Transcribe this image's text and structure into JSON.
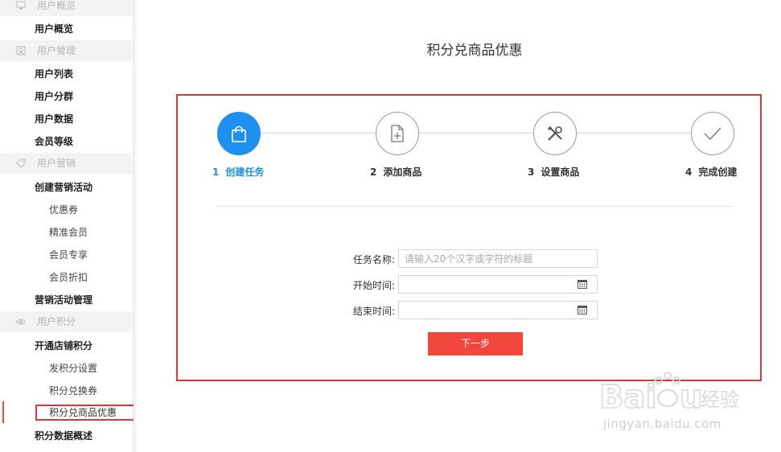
{
  "sidebar": {
    "groups": [
      {
        "label": "用户概览",
        "icon": "monitor-icon"
      },
      {
        "label": "用户管理",
        "icon": "user-card-icon"
      },
      {
        "label": "用户营销",
        "icon": "tag-icon"
      },
      {
        "label": "用户积分",
        "icon": "eye-icon"
      }
    ],
    "items": {
      "overview": "用户概览",
      "user_list": "用户列表",
      "user_group": "用户分群",
      "user_data": "用户数据",
      "member_level": "会员等级",
      "create_campaign": "创建营销活动",
      "coupon": "优惠券",
      "precise_member": "精准会员",
      "member_exclusive": "会员专享",
      "member_discount": "会员折扣",
      "campaign_manage": "营销活动管理",
      "open_points": "开通店铺积分",
      "issue_points": "发积分设置",
      "points_coupon": "积分兑换券",
      "points_goods": "积分兑商品优惠",
      "points_overview": "积分数据概述"
    }
  },
  "main": {
    "title": "积分兑商品优惠",
    "steps": [
      {
        "num": "1",
        "label": "创建任务",
        "icon": "shopping-bag-icon",
        "active": true
      },
      {
        "num": "2",
        "label": "添加商品",
        "icon": "add-file-icon",
        "active": false
      },
      {
        "num": "3",
        "label": "设置商品",
        "icon": "tools-icon",
        "active": false
      },
      {
        "num": "4",
        "label": "完成创建",
        "icon": "check-icon",
        "active": false
      }
    ],
    "form": {
      "task_name_label": "任务名称:",
      "task_name_placeholder": "请输入20个汉字或字符的标题",
      "start_label": "开始时间:",
      "end_label": "结束时间:"
    },
    "next_button": "下一步"
  },
  "watermark": {
    "brand": "Baidu经验",
    "url": "jingyan.baidu.com"
  },
  "colors": {
    "accent_blue": "#1e90ef",
    "button_red": "#f0463c",
    "highlight_red": "#d9363e"
  }
}
